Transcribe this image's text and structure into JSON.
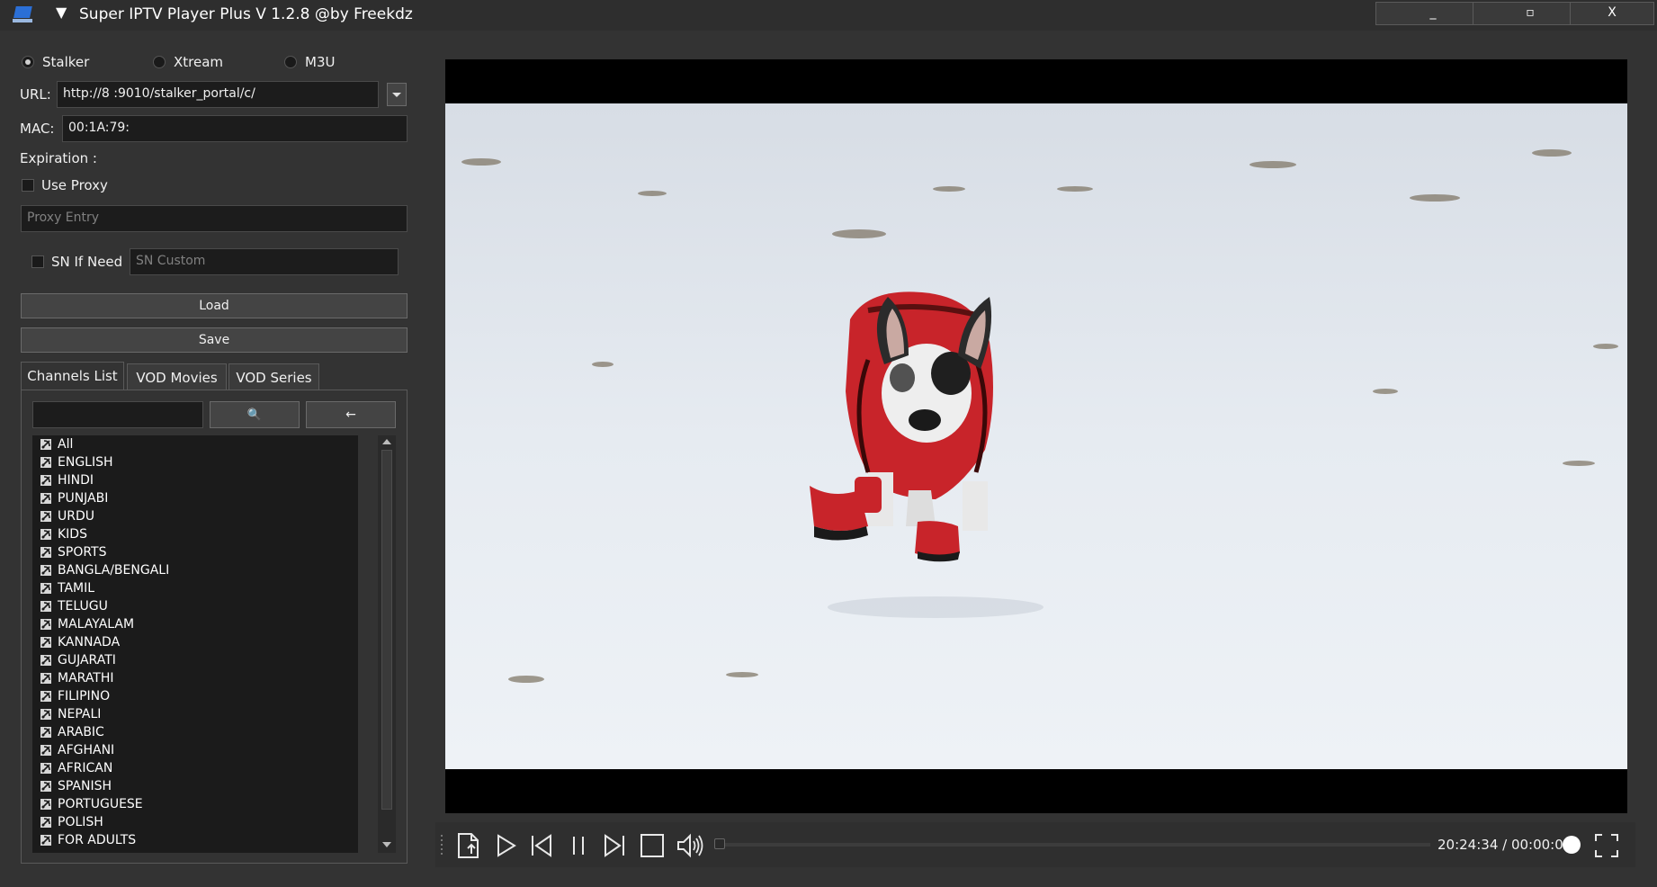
{
  "window": {
    "title": "Super IPTV Player Plus V 1.2.8 @by Freekdz",
    "menu_arrow": "▼",
    "minimize": "_",
    "maximize": "▫",
    "close": "X"
  },
  "source": {
    "options": [
      "Stalker",
      "Xtream",
      "M3U"
    ],
    "selected": "Stalker"
  },
  "form": {
    "url_label": "URL:",
    "url_value": "http://8                     :9010/stalker_portal/c/",
    "mac_label": "MAC:",
    "mac_value": "00:1A:79:",
    "expiration_label": "Expiration :",
    "use_proxy_label": "Use Proxy",
    "proxy_placeholder": "Proxy Entry",
    "sn_label": "SN If Need",
    "sn_placeholder": "SN Custom",
    "load_label": "Load",
    "save_label": "Save"
  },
  "tabs": [
    "Channels List",
    "VOD Movies",
    "VOD Series"
  ],
  "active_tab": "Channels List",
  "search": {
    "value": "",
    "search_icon": "🔍",
    "back_label": "←"
  },
  "channels": [
    "All",
    "ENGLISH",
    "HINDI",
    "PUNJABI",
    "URDU",
    "KIDS",
    "SPORTS",
    "BANGLA/BENGALI",
    "TAMIL",
    "TELUGU",
    "MALAYALAM",
    "KANNADA",
    "GUJARATI",
    "MARATHI",
    "FILIPINO",
    "NEPALI",
    "ARABIC",
    "AFGHANI",
    "AFRICAN",
    "SPANISH",
    "PORTUGUESE",
    "POLISH",
    "FOR ADULTS"
  ],
  "player": {
    "time": "20:24:34 / 00:00:00",
    "icons": [
      "open-file-icon",
      "play-icon",
      "previous-icon",
      "pause-icon",
      "next-icon",
      "stop-icon",
      "volume-icon",
      "fullscreen-icon"
    ]
  },
  "colors": {
    "background": "#333333",
    "field": "#1c1c1c",
    "video_black": "#000000"
  }
}
